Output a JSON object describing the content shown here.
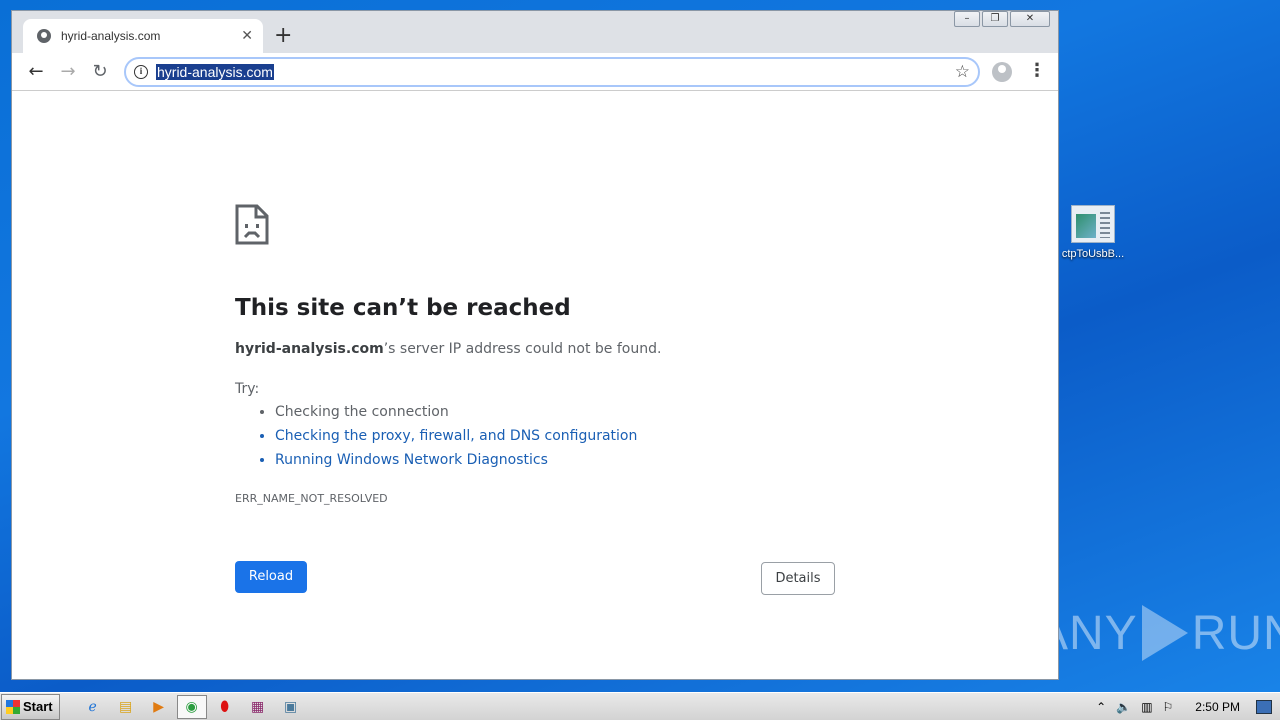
{
  "browser": {
    "tab_title": "hyrid-analysis.com",
    "new_tab_symbol": "+",
    "url": "hyrid-analysis.com",
    "window_controls": [
      "–",
      "❐",
      "✕"
    ]
  },
  "error_page": {
    "title": "This site can’t be reached",
    "host": "hyrid-analysis.com",
    "description_suffix": "’s server IP address could not be found.",
    "try_label": "Try:",
    "suggestions": [
      "Checking the connection",
      "Checking the proxy, firewall, and DNS configuration",
      "Running Windows Network Diagnostics"
    ],
    "error_code": "ERR_NAME_NOT_RESOLVED",
    "reload_label": "Reload",
    "details_label": "Details"
  },
  "desktop": {
    "icon_label": "ctpToUsbB...",
    "watermark_left": "ANY",
    "watermark_right": "RUN"
  },
  "taskbar": {
    "start_label": "Start",
    "clock": "2:50 PM",
    "pinned_icons": [
      "ie-icon",
      "explorer-icon",
      "media-player-icon",
      "chrome-icon",
      "opera-icon",
      "winrar-icon",
      "app-window-icon"
    ]
  },
  "colors": {
    "link": "#1a5fb4",
    "reload_button": "#1a73e8",
    "url_selection": "#1a3f8f"
  }
}
